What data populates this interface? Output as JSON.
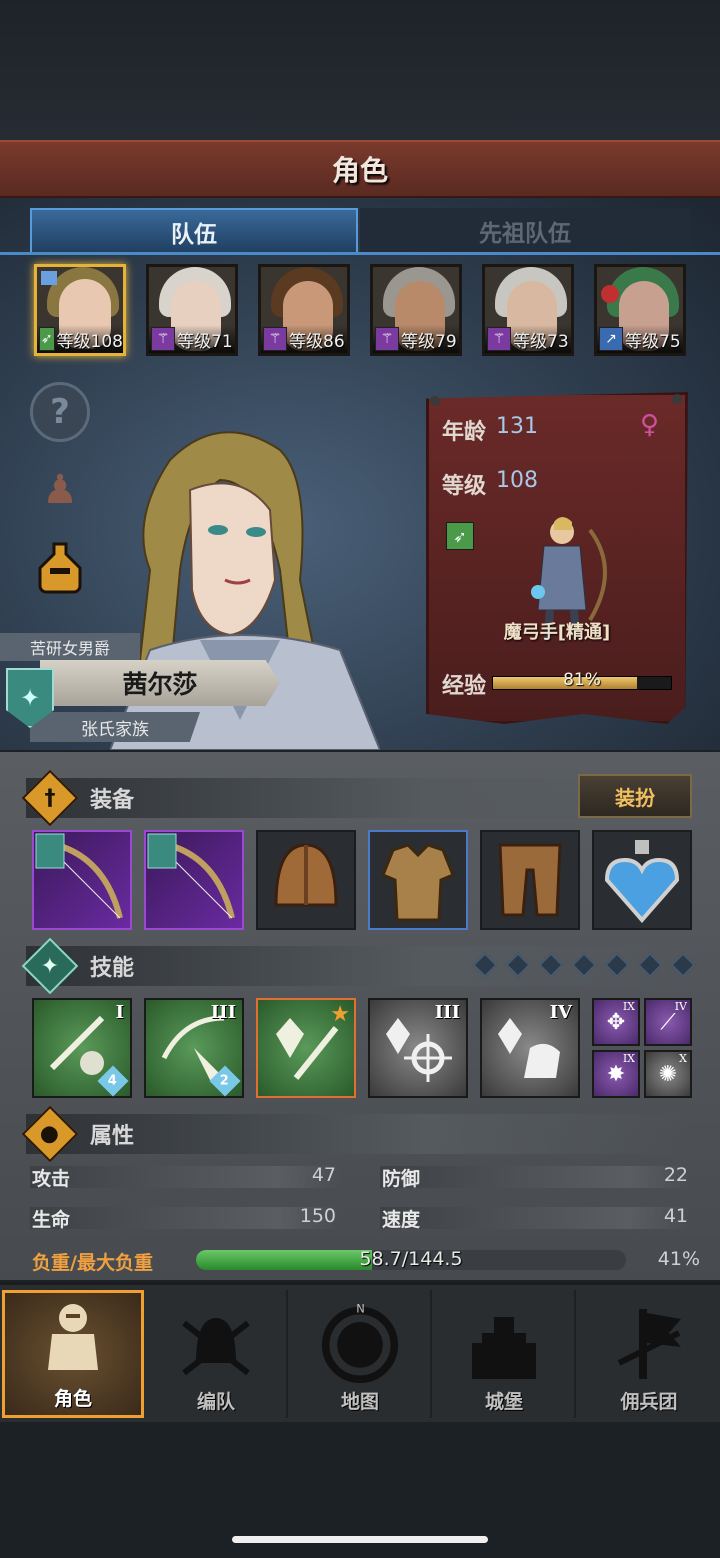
{
  "header": {
    "title": "角色"
  },
  "tabs": [
    {
      "label": "队伍",
      "active": true
    },
    {
      "label": "先祖队伍",
      "active": false
    }
  ],
  "team": [
    {
      "level_text": "等级108",
      "class_color": "#4a9a4a",
      "selected": true
    },
    {
      "level_text": "等级71",
      "class_color": "#7a3aa0",
      "selected": false
    },
    {
      "level_text": "等级86",
      "class_color": "#7a3aa0",
      "selected": false
    },
    {
      "level_text": "等级79",
      "class_color": "#7a3aa0",
      "selected": false
    },
    {
      "level_text": "等级73",
      "class_color": "#7a3aa0",
      "selected": false
    },
    {
      "level_text": "等级75",
      "class_color": "#3a6ab0",
      "selected": false
    }
  ],
  "side_buttons": [
    "help-icon",
    "person-icon",
    "potion-icon"
  ],
  "hero": {
    "title": "苦研女男爵",
    "name": "茜尔莎",
    "family": "张氏家族"
  },
  "info": {
    "age_label": "年龄",
    "age_value": "131",
    "level_label": "等级",
    "level_value": "108",
    "gender_icon": "female-icon",
    "class_name": "魔弓手[精通]",
    "exp_label": "经验",
    "exp_text": "81%",
    "exp_pct": 81
  },
  "equipment": {
    "section_title": "装备",
    "dress_label": "装扮",
    "items": [
      {
        "name": "bow",
        "rarity": "purple"
      },
      {
        "name": "bow",
        "rarity": "purple"
      },
      {
        "name": "helmet",
        "rarity": "normal"
      },
      {
        "name": "armor",
        "rarity": "blue"
      },
      {
        "name": "boots",
        "rarity": "normal"
      },
      {
        "name": "amulet",
        "rarity": "normal"
      }
    ]
  },
  "skills": {
    "section_title": "技能",
    "slots": [
      {
        "name": "sword-aura",
        "rank": "I",
        "gems": "4",
        "style": "green"
      },
      {
        "name": "arrow-strike",
        "rank": "III",
        "gems": "2",
        "style": "green"
      },
      {
        "name": "crystal-wand",
        "rank": "",
        "gems": "",
        "style": "green-orange"
      },
      {
        "name": "crystal-burst",
        "rank": "III",
        "gems": "",
        "style": "gray"
      },
      {
        "name": "crystal-shield",
        "rank": "IV",
        "gems": "",
        "style": "gray"
      }
    ],
    "mini": [
      {
        "rank": "IX",
        "style": "p"
      },
      {
        "rank": "IV",
        "style": "p"
      },
      {
        "rank": "IX",
        "style": "p"
      },
      {
        "rank": "X",
        "style": "g"
      }
    ]
  },
  "attributes": {
    "section_title": "属性",
    "attack_label": "攻击",
    "attack": "47",
    "defense_label": "防御",
    "defense": "22",
    "hp_label": "生命",
    "hp": "150",
    "speed_label": "速度",
    "speed": "41",
    "weight_label": "负重/最大负重",
    "weight_text": "58.7/144.5",
    "weight_pct_text": "41%",
    "weight_pct": 41
  },
  "nav": [
    {
      "label": "角色",
      "active": true
    },
    {
      "label": "编队",
      "active": false
    },
    {
      "label": "地图",
      "active": false
    },
    {
      "label": "城堡",
      "active": false
    },
    {
      "label": "佣兵团",
      "active": false
    }
  ],
  "map_compass": "N",
  "colors": {
    "accent_gold": "#e6b33a",
    "tab_blue": "#4a8ac8",
    "exp_gold": "#e0b050",
    "weight_green": "#4ab04a",
    "weight_label": "#f0a040"
  }
}
